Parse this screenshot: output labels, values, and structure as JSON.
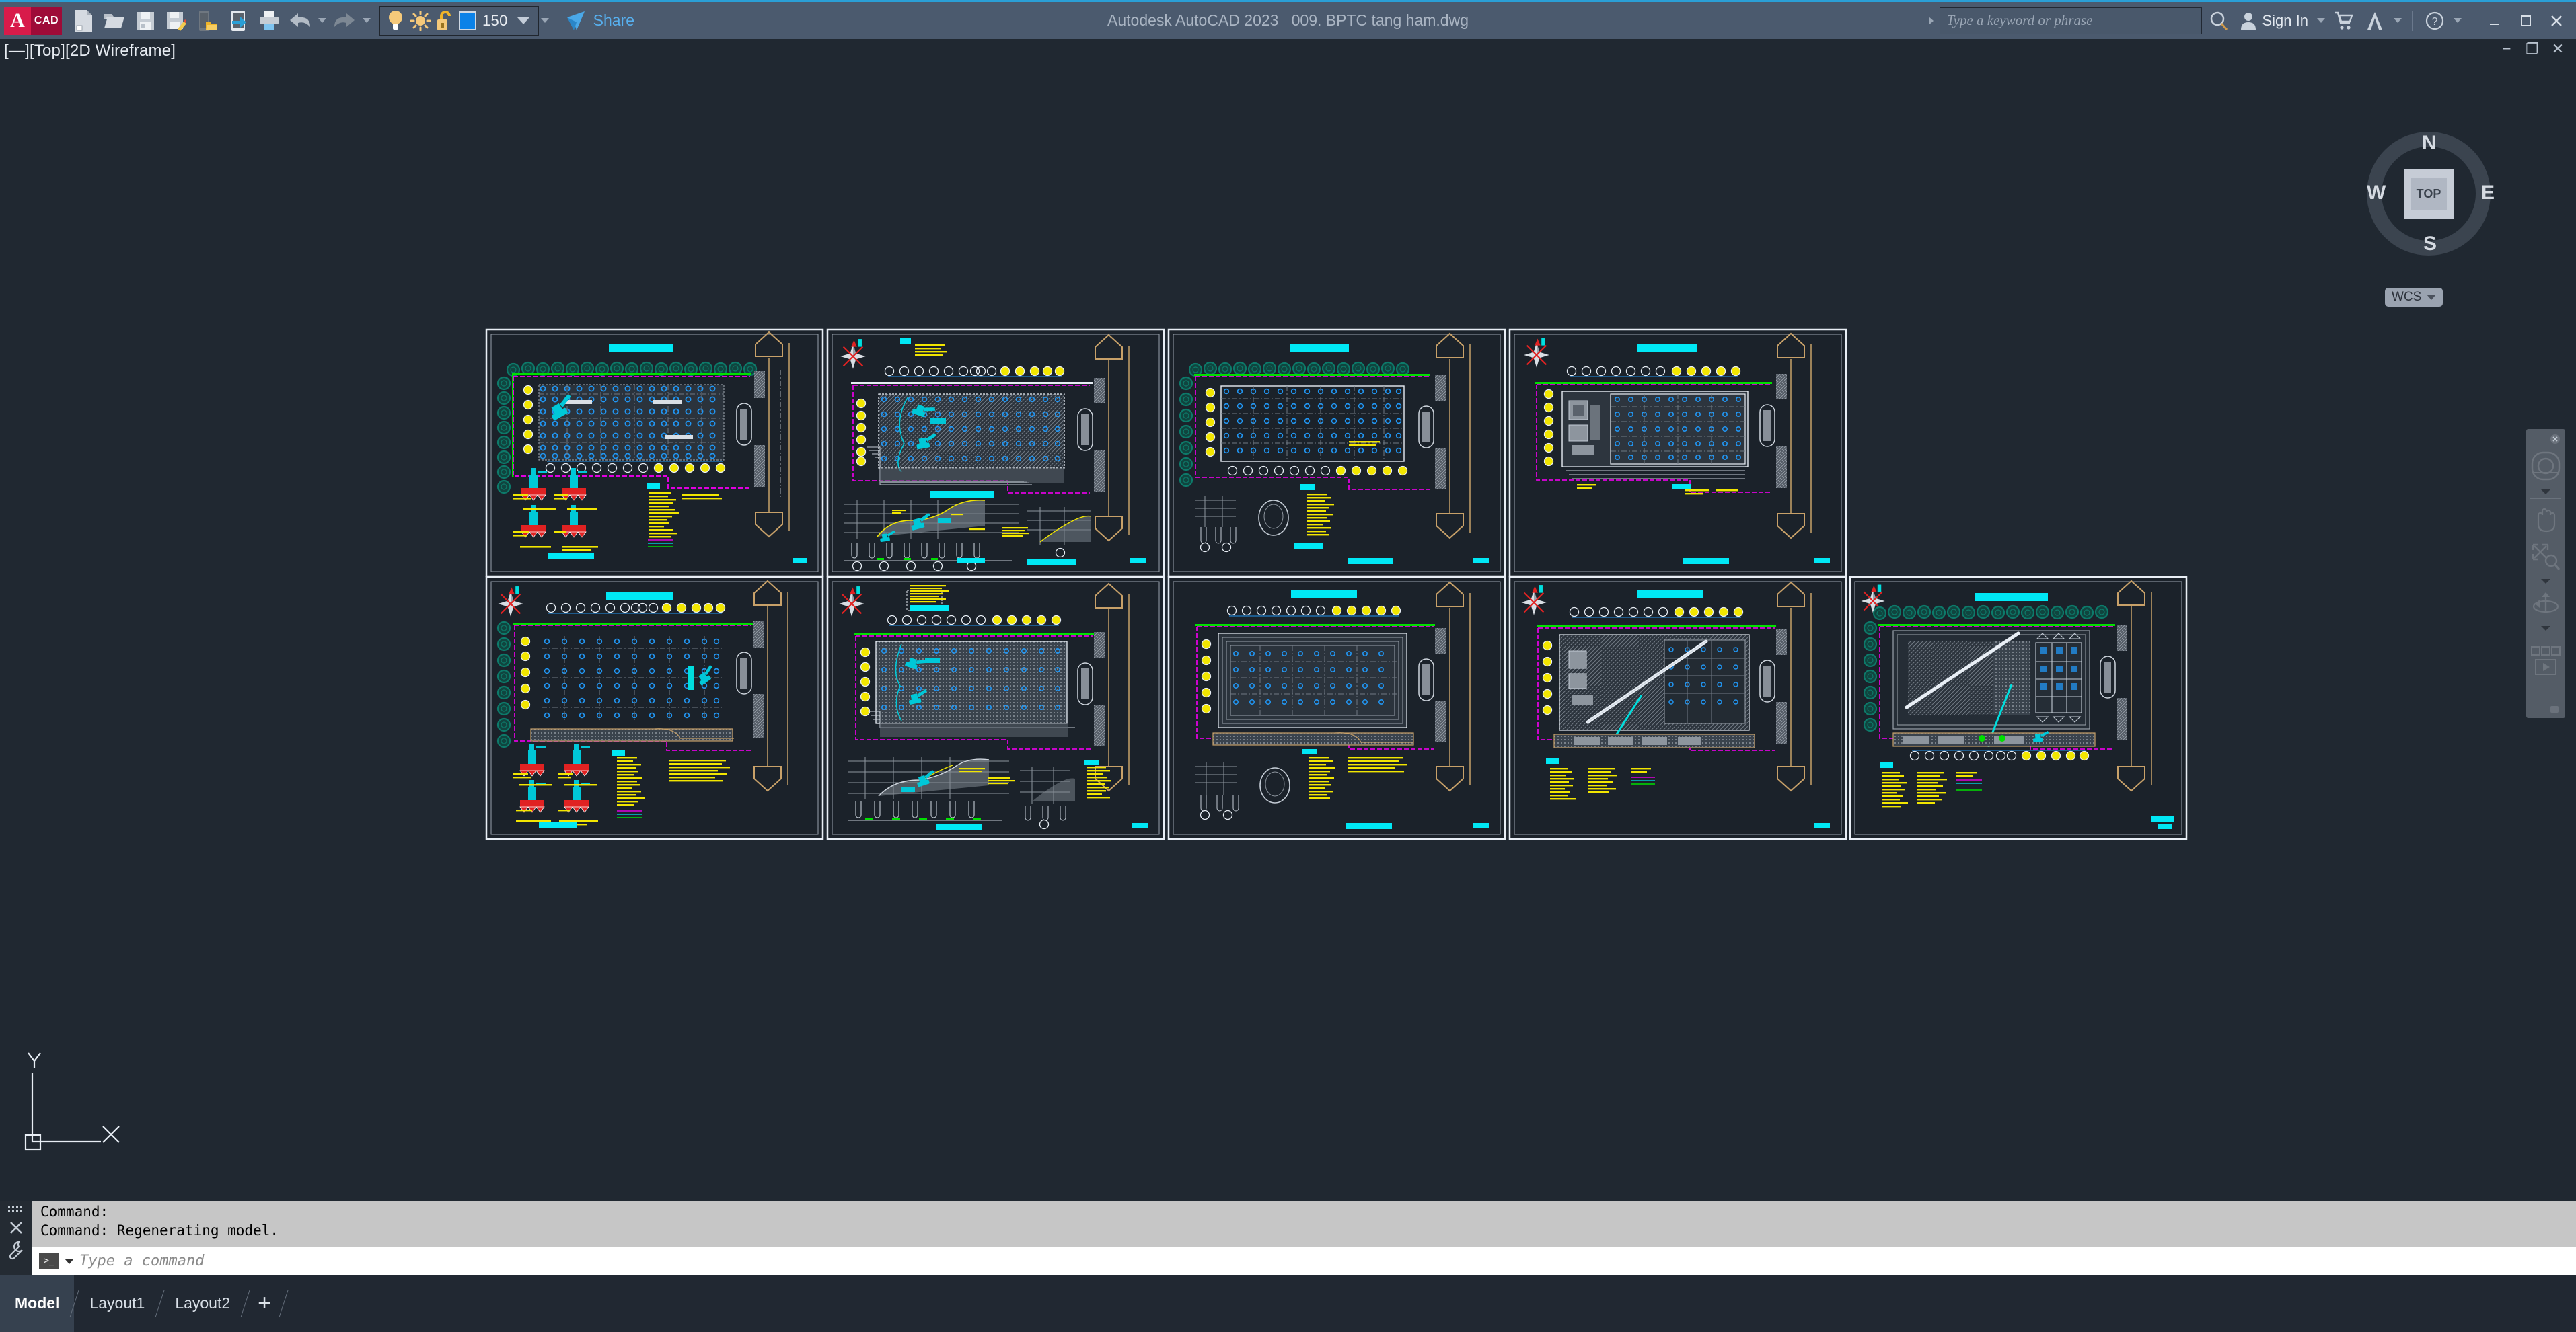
{
  "app": {
    "product_name": "Autodesk AutoCAD 2023",
    "file_name": "009. BPTC tang ham.dwg",
    "title_text": "Autodesk AutoCAD 2023   009. BPTC tang ham.dwg",
    "accent_color": "#2a9fd6",
    "titlebar_color": "#4b5a6e",
    "canvas_bg": "#202831",
    "logo_letter": "A",
    "logo_text": "CAD"
  },
  "quick_access_toolbar": {
    "items": [
      {
        "name": "new-drawing",
        "label": "New",
        "icon": "new-file-icon"
      },
      {
        "name": "open-drawing",
        "label": "Open",
        "icon": "open-folder-icon"
      },
      {
        "name": "save-drawing",
        "label": "Save",
        "icon": "floppy-save-icon"
      },
      {
        "name": "save-as",
        "label": "Save As",
        "icon": "floppy-pencil-icon"
      },
      {
        "name": "open-from-web",
        "label": "Open from Web & Mobile",
        "icon": "device-folder-icon"
      },
      {
        "name": "save-to-web",
        "label": "Save to Web & Mobile",
        "icon": "device-arrow-icon"
      },
      {
        "name": "plot",
        "label": "Plot",
        "icon": "printer-icon"
      },
      {
        "name": "undo",
        "label": "Undo",
        "icon": "undo-arrow-icon"
      },
      {
        "name": "undo-dropdown",
        "label": "Undo options",
        "icon": "chevron-down-icon"
      },
      {
        "name": "redo",
        "label": "Redo",
        "icon": "redo-arrow-icon"
      },
      {
        "name": "redo-dropdown",
        "label": "Redo options",
        "icon": "chevron-down-icon"
      }
    ]
  },
  "layer_control": {
    "layer_name": "150",
    "color_swatch": "#0b82e8",
    "on_icon": "lightbulb-on-icon",
    "thaw_icon": "sun-icon",
    "lock_icon": "padlock-unlocked-icon",
    "dropdown_icon": "chevron-down-icon",
    "qat_more_icon": "customize-qat-icon"
  },
  "share": {
    "label": "Share",
    "icon": "share-paper-plane-icon"
  },
  "search": {
    "placeholder": "Type a keyword or phrase",
    "value": "",
    "expand_icon": "chevron-right-icon",
    "search_icon": "search-icon"
  },
  "account": {
    "sign_in_label": "Sign In",
    "user_icon": "user-icon",
    "dropdown_icon": "chevron-down-icon",
    "autodesk_app_store_icon": "shopping-cart-icon",
    "app_icon": "autodesk-a-icon",
    "help_icon": "question-mark-icon"
  },
  "window_controls": {
    "minimize": "minimize-icon",
    "restore": "restore-icon",
    "close": "close-icon"
  },
  "document_window_controls": {
    "minimize": "−",
    "restore": "❐",
    "close": "✕"
  },
  "viewport": {
    "label": "[—][Top][2D Wireframe]",
    "visual_style": "2D Wireframe",
    "view": "Top"
  },
  "viewcube": {
    "face_label": "TOP",
    "compass": {
      "north": "N",
      "south": "S",
      "east": "E",
      "west": "W"
    },
    "ucs_label": "WCS",
    "ucs_dropdown_icon": "chevron-down-icon"
  },
  "navigation_bar": {
    "items": [
      {
        "name": "steering-wheel",
        "icon": "steering-wheel-icon"
      },
      {
        "name": "pan",
        "icon": "hand-pan-icon"
      },
      {
        "name": "zoom-extents",
        "icon": "zoom-magnifier-icon"
      },
      {
        "name": "orbit",
        "icon": "orbit-icon"
      },
      {
        "name": "showmotion",
        "icon": "showmotion-play-icon"
      }
    ],
    "close_icon": "close-circle-icon"
  },
  "ucs_icon": {
    "x_label": "X",
    "y_label": "Y"
  },
  "command_line": {
    "history": [
      "Command:",
      "Command: Regenerating model."
    ],
    "placeholder": "Type a command",
    "value": "",
    "prompt_icon": "command-prompt-icon",
    "dropdown_icon": "chevron-down-icon",
    "close_icon": "close-icon",
    "customize_icon": "wrench-icon",
    "grip_icon": "drag-grip-icon"
  },
  "layout_tabs": {
    "tabs": [
      {
        "label": "Model",
        "active": true
      },
      {
        "label": "Layout1",
        "active": false
      },
      {
        "label": "Layout2",
        "active": false
      }
    ],
    "add_label": "+"
  },
  "drawing": {
    "description": "AutoCAD model space showing nine construction-method (BPTC) basement site plan sheets arranged in two rows",
    "sheet_border_color": "#e8eef5",
    "title_block_color": "#00e8f5",
    "pile_color": "#2196f3",
    "annotation_color": "#f2e600",
    "boundary_green": "#00e000",
    "boundary_magenta": "#e000e0",
    "equipment_cyan": "#00dede",
    "equipment_red": "#e02222",
    "tree_color": "#0d5b52",
    "rows": [
      {
        "row": 1,
        "sheets": [
          {
            "id": "sheet-1",
            "has_north_arrow": false,
            "has_section": false,
            "has_equipment_legend": true
          },
          {
            "id": "sheet-2",
            "has_north_arrow": true,
            "has_section": true,
            "has_equipment_legend": false
          },
          {
            "id": "sheet-3",
            "has_north_arrow": false,
            "has_section": true,
            "has_equipment_legend": false
          },
          {
            "id": "sheet-4",
            "has_north_arrow": true,
            "has_section": false,
            "has_equipment_legend": false
          }
        ]
      },
      {
        "row": 2,
        "sheets": [
          {
            "id": "sheet-5",
            "has_north_arrow": true,
            "has_section": false,
            "has_equipment_legend": true
          },
          {
            "id": "sheet-6",
            "has_north_arrow": true,
            "has_section": true,
            "has_equipment_legend": false
          },
          {
            "id": "sheet-7",
            "has_north_arrow": false,
            "has_section": true,
            "has_equipment_legend": false
          },
          {
            "id": "sheet-8",
            "has_north_arrow": true,
            "has_section": false,
            "has_equipment_legend": false
          },
          {
            "id": "sheet-9",
            "has_north_arrow": true,
            "has_section": false,
            "has_equipment_legend": false
          }
        ]
      }
    ]
  }
}
